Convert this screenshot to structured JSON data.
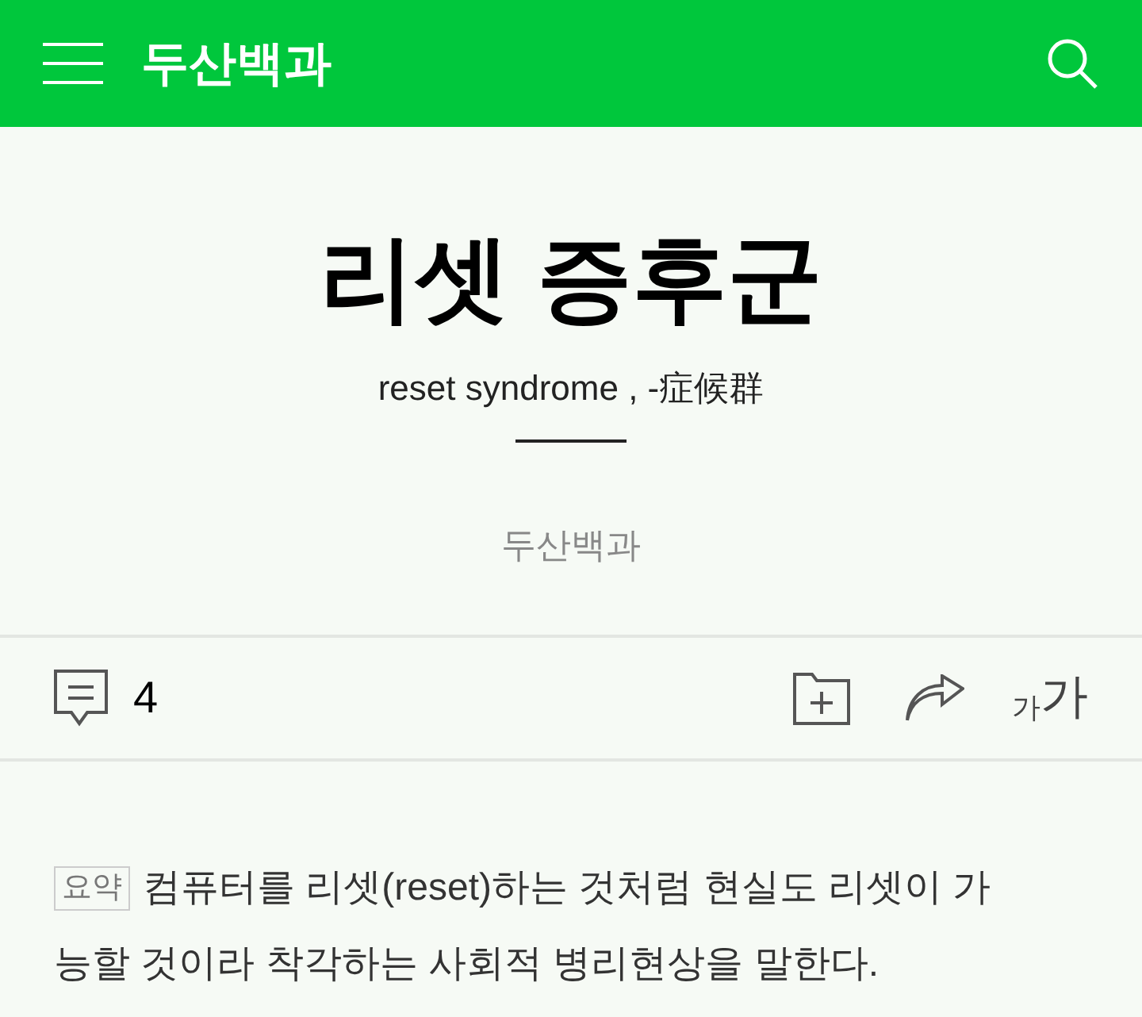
{
  "header": {
    "title": "두산백과"
  },
  "article": {
    "title": "리셋 증후군",
    "subtitle": "reset syndrome , -症候群",
    "source": "두산백과"
  },
  "toolbar": {
    "comment_count": "4",
    "font_size": {
      "small": "가",
      "large": "가"
    }
  },
  "summary": {
    "tag": "요약",
    "text": "컴퓨터를 리셋(reset)하는 것처럼 현실도 리셋이 가능할 것이라 착각하는 사회적 병리현상을 말한다."
  }
}
